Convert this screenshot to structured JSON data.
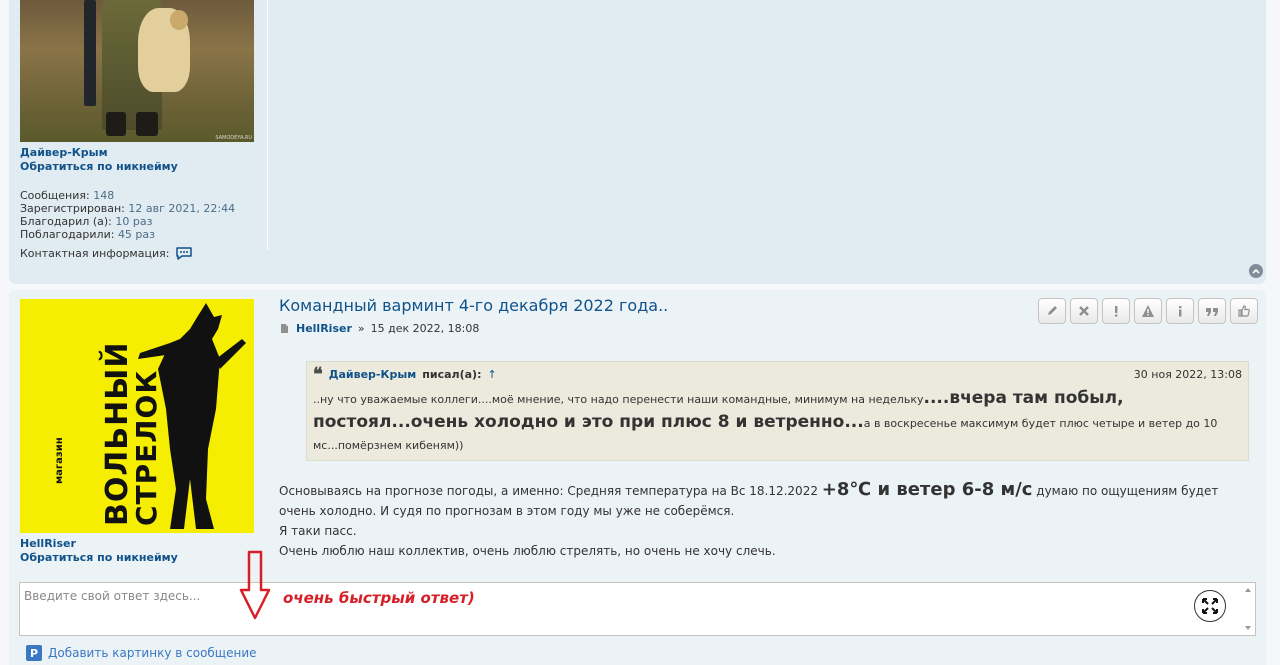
{
  "post1": {
    "username": "Дайвер-Крым",
    "nick_link": "Обратиться по никнейму",
    "stats": [
      {
        "label": "Сообщения:",
        "value": "148"
      },
      {
        "label": "Зарегистрирован:",
        "value": "12 авг 2021, 22:44"
      },
      {
        "label": "Благодарил (а):",
        "value": "10 раз"
      },
      {
        "label": "Поблагодарили:",
        "value": "45 раз"
      }
    ],
    "contact_label": "Контактная информация:",
    "avatar_watermark": "SAMODEYA.RU"
  },
  "post2": {
    "avatar_logo": {
      "line1": "ВОЛЬНЫЙ",
      "line2": "СТРЕЛОК",
      "small": "магазин"
    },
    "username": "HellRiser",
    "nick_link": "Обратиться по никнейму",
    "title": "Командный варминт 4-го декабря 2022 года..",
    "author": "HellRiser",
    "meta_sep": "»",
    "date": "15 дек 2022, 18:08",
    "quote": {
      "author": "Дайвер-Крым",
      "said": "писал(а):",
      "arrow": "↑",
      "date": "30 ноя 2022, 13:08",
      "part1": "..ну что уважаемые коллеги....моё мнение, что надо перенести наши командные, минимум на недельку",
      "part2": "....вчера там побыл, постоял...очень холодно и это при плюс 8 и ветренно...",
      "part3": "а в воскресенье максимум будет плюс четыре и ветер до 10 мс...помёрзнем кибеням))"
    },
    "content": {
      "p1_start": "Основываясь на прогнозе погоды, а именно: Средняя температура на Вс 18.12.2022 ",
      "p1_big": "+8℃ и ветер 6-8 м/с",
      "p1_end": " думаю по ощущениям будет очень холодно. И судя по прогнозам в этом году мы уже не соберёмся.",
      "p2": "Я таки пасс.",
      "p3": "Очень люблю наш коллектив, очень люблю стрелять, но очень не хочу слечь."
    }
  },
  "reply": {
    "placeholder": "Введите свой ответ здесь...",
    "annotation": "очень быстрый ответ)"
  },
  "add_image_label": "Добавить картинку в сообщение",
  "add_image_icon_letter": "P",
  "colors": {
    "link": "#105289",
    "annotation": "#d62027",
    "avatar_bg": "#f6ee00",
    "post1_bg": "#e1ebf2",
    "post2_bg": "#ecf3f7"
  }
}
